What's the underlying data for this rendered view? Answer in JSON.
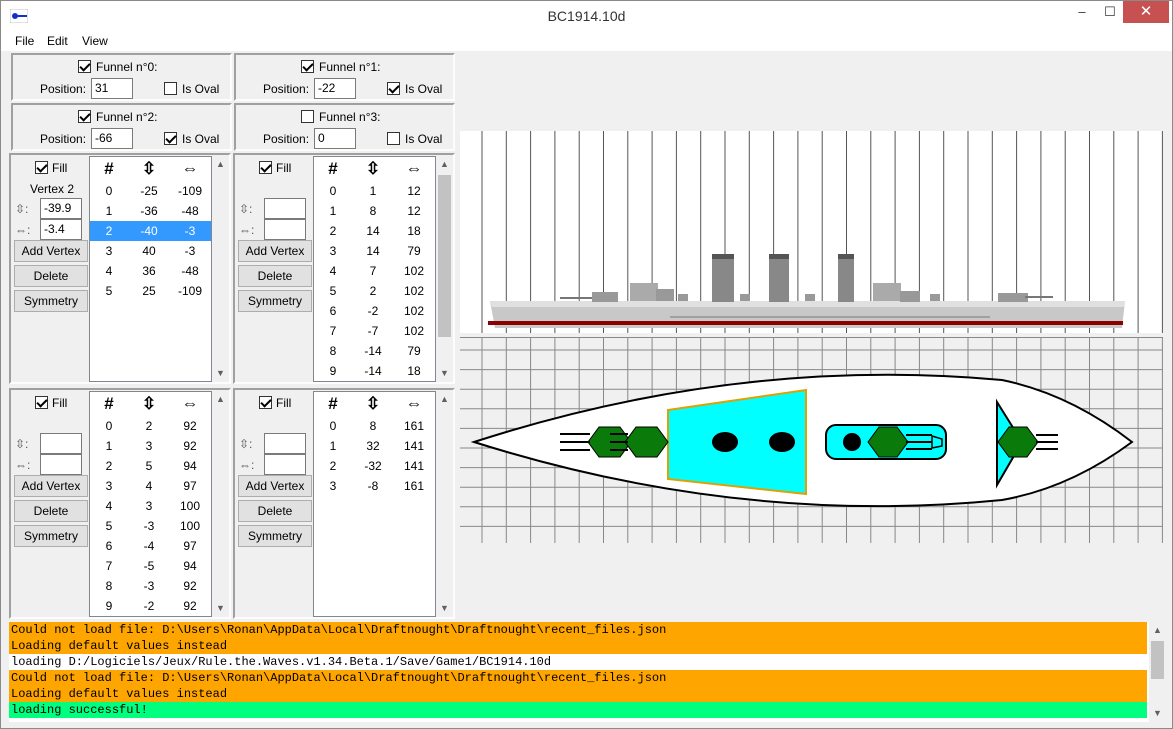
{
  "window": {
    "title": "BC1914.10d"
  },
  "menu": {
    "file": "File",
    "edit": "Edit",
    "view": "View"
  },
  "window_buttons": {
    "minimize": "–",
    "maximize": "☐",
    "close": "✕"
  },
  "funnels": [
    {
      "label": "Funnel n°0:",
      "enabled": true,
      "position_label": "Position:",
      "position": "31",
      "oval_label": "Is Oval",
      "is_oval": false
    },
    {
      "label": "Funnel n°1:",
      "enabled": true,
      "position_label": "Position:",
      "position": "-22",
      "oval_label": "Is Oval",
      "is_oval": true
    },
    {
      "label": "Funnel n°2:",
      "enabled": true,
      "position_label": "Position:",
      "position": "-66",
      "oval_label": "Is Oval",
      "is_oval": true
    },
    {
      "label": "Funnel n°3:",
      "enabled": false,
      "position_label": "Position:",
      "position": "0",
      "oval_label": "Is Oval",
      "is_oval": false
    }
  ],
  "editors": [
    {
      "fill_label": "Fill",
      "fill": true,
      "vertex_label": "Vertex 2",
      "vert_glyph": "⇳:",
      "horiz_glyph": "⇔:",
      "vert_value": "-39.9",
      "horiz_value": "-3.4",
      "add_label": "Add Vertex",
      "delete_label": "Delete",
      "symmetry_label": "Symmetry",
      "headers": [
        "#",
        "⇳",
        "⇔"
      ],
      "selected": 2,
      "rows": [
        [
          "0",
          "-25",
          "-109"
        ],
        [
          "1",
          "-36",
          "-48"
        ],
        [
          "2",
          "-40",
          "-3"
        ],
        [
          "3",
          "40",
          "-3"
        ],
        [
          "4",
          "36",
          "-48"
        ],
        [
          "5",
          "25",
          "-109"
        ]
      ]
    },
    {
      "fill_label": "Fill",
      "fill": true,
      "vertex_label": "",
      "vert_glyph": "⇳:",
      "horiz_glyph": "⇔:",
      "vert_value": "",
      "horiz_value": "",
      "add_label": "Add Vertex",
      "delete_label": "Delete",
      "symmetry_label": "Symmetry",
      "headers": [
        "#",
        "⇳",
        "⇔"
      ],
      "selected": -1,
      "rows": [
        [
          "0",
          "1",
          "12"
        ],
        [
          "1",
          "8",
          "12"
        ],
        [
          "2",
          "14",
          "18"
        ],
        [
          "3",
          "14",
          "79"
        ],
        [
          "4",
          "7",
          "102"
        ],
        [
          "5",
          "2",
          "102"
        ],
        [
          "6",
          "-2",
          "102"
        ],
        [
          "7",
          "-7",
          "102"
        ],
        [
          "8",
          "-14",
          "79"
        ],
        [
          "9",
          "-14",
          "18"
        ]
      ]
    },
    {
      "fill_label": "Fill",
      "fill": true,
      "vertex_label": "",
      "vert_glyph": "⇳:",
      "horiz_glyph": "⇔:",
      "vert_value": "",
      "horiz_value": "",
      "add_label": "Add Vertex",
      "delete_label": "Delete",
      "symmetry_label": "Symmetry",
      "headers": [
        "#",
        "⇳",
        "⇔"
      ],
      "selected": -1,
      "rows": [
        [
          "0",
          "2",
          "92"
        ],
        [
          "1",
          "3",
          "92"
        ],
        [
          "2",
          "5",
          "94"
        ],
        [
          "3",
          "4",
          "97"
        ],
        [
          "4",
          "3",
          "100"
        ],
        [
          "5",
          "-3",
          "100"
        ],
        [
          "6",
          "-4",
          "97"
        ],
        [
          "7",
          "-5",
          "94"
        ],
        [
          "8",
          "-3",
          "92"
        ],
        [
          "9",
          "-2",
          "92"
        ]
      ]
    },
    {
      "fill_label": "Fill",
      "fill": true,
      "vertex_label": "",
      "vert_glyph": "⇳:",
      "horiz_glyph": "⇔:",
      "vert_value": "",
      "horiz_value": "",
      "add_label": "Add Vertex",
      "delete_label": "Delete",
      "symmetry_label": "Symmetry",
      "headers": [
        "#",
        "⇳",
        "⇔"
      ],
      "selected": -1,
      "rows": [
        [
          "0",
          "8",
          "161"
        ],
        [
          "1",
          "32",
          "141"
        ],
        [
          "2",
          "-32",
          "141"
        ],
        [
          "3",
          "-8",
          "161"
        ]
      ]
    }
  ],
  "log": [
    {
      "text": "Could not load file: D:\\Users\\Ronan\\AppData\\Local\\Draftnought\\Draftnought\\recent_files.json",
      "level": "warning"
    },
    {
      "text": "Loading default values instead",
      "level": "warning"
    },
    {
      "text": "loading D:/Logiciels/Jeux/Rule.the.Waves.v1.34.Beta.1/Save/Game1/BC1914.10d",
      "level": "info"
    },
    {
      "text": "Could not load file: D:\\Users\\Ronan\\AppData\\Local\\Draftnought\\Draftnought\\recent_files.json",
      "level": "warning"
    },
    {
      "text": "Loading default values instead",
      "level": "warning"
    },
    {
      "text": "loading successful!",
      "level": "success"
    }
  ],
  "colors": {
    "warning": "#ffa500",
    "info": "#ffffff",
    "success": "#00ff7f",
    "selection": "#3399ff",
    "deck_fill": "#00ffff",
    "turret": "#0a7a0a",
    "hull_keel": "#8b0000"
  }
}
